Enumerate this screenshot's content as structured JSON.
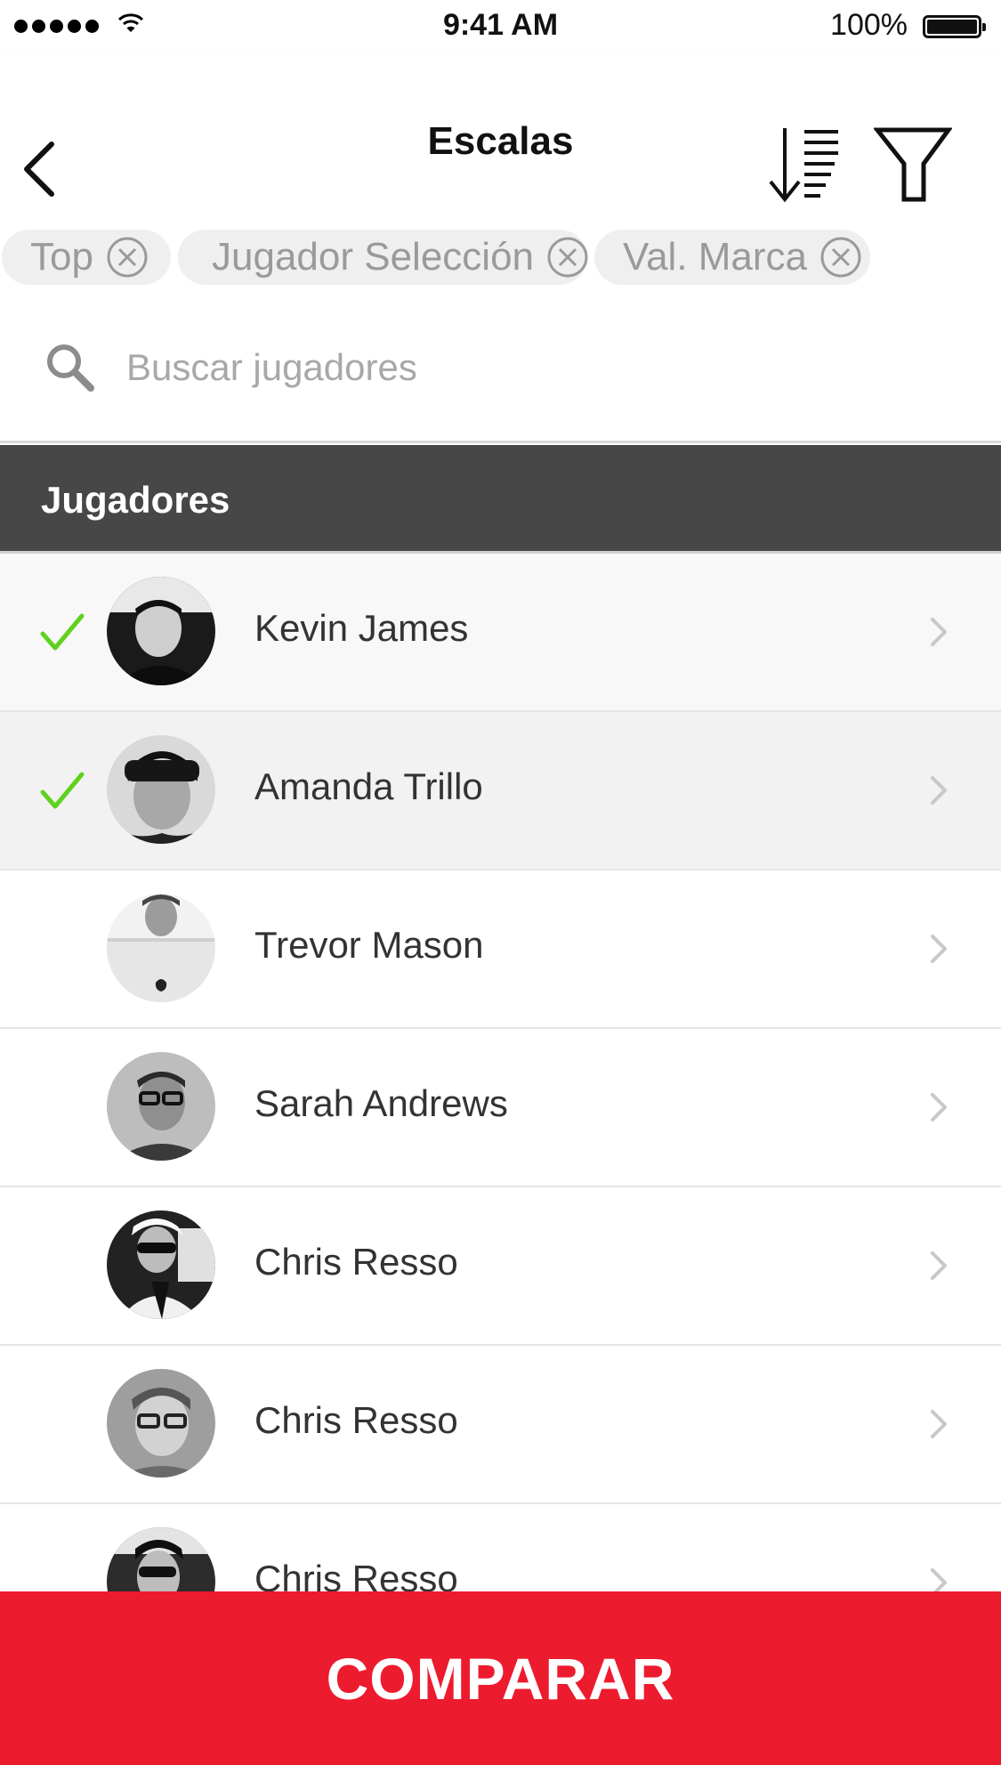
{
  "status_bar": {
    "time": "9:41 AM",
    "battery": "100%"
  },
  "nav": {
    "title": "Escalas"
  },
  "filters": [
    {
      "label": "Top"
    },
    {
      "label": "Jugador Selección"
    },
    {
      "label": "Val. Marca"
    }
  ],
  "search": {
    "placeholder": "Buscar jugadores",
    "value": ""
  },
  "section": {
    "title": "Jugadores"
  },
  "players": [
    {
      "name": "Kevin James",
      "selected": true
    },
    {
      "name": "Amanda Trillo",
      "selected": true
    },
    {
      "name": "Trevor Mason",
      "selected": false
    },
    {
      "name": "Sarah Andrews",
      "selected": false
    },
    {
      "name": "Chris Resso",
      "selected": false
    },
    {
      "name": "Chris Resso",
      "selected": false
    },
    {
      "name": "Chris Resso",
      "selected": false
    }
  ],
  "compare_button": {
    "label": "COMPARAR"
  },
  "colors": {
    "accent": "#ed1b2e",
    "check": "#5fd11e",
    "section_header": "#474747"
  },
  "icons": {
    "back": "chevron-left-icon",
    "sort": "sort-descending-icon",
    "filter": "funnel-icon",
    "search": "magnifier-icon",
    "chip_close": "circle-x-icon",
    "row_check": "checkmark-icon",
    "row_disclosure": "chevron-right-icon"
  }
}
